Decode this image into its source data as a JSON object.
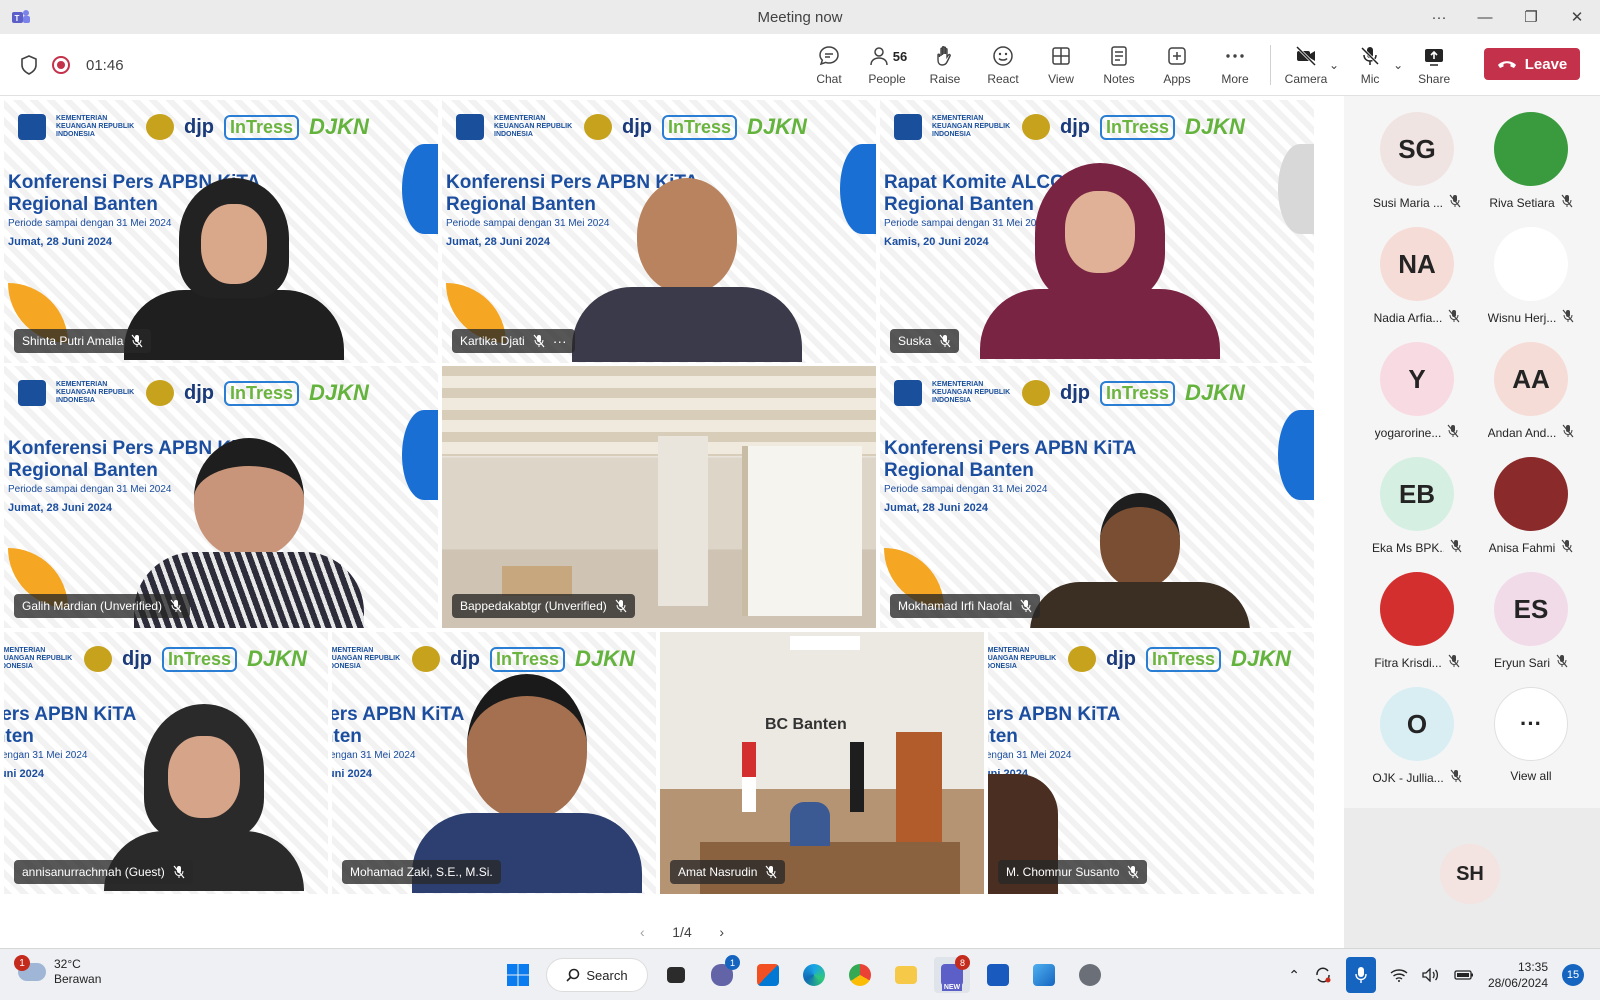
{
  "window": {
    "title": "Meeting now"
  },
  "toolbar": {
    "timer": "01:46",
    "chat": "Chat",
    "people": "People",
    "people_count": "56",
    "raise": "Raise",
    "react": "React",
    "view": "View",
    "notes": "Notes",
    "apps": "Apps",
    "more": "More",
    "camera": "Camera",
    "mic": "Mic",
    "share": "Share",
    "leave": "Leave"
  },
  "banner": {
    "org_small": "KEMENTERIAN KEUANGAN REPUBLIK INDONESIA",
    "djp": "djp",
    "intress": "InTress",
    "djkn": "DJKN",
    "headline_a": "Konferensi Pers APBN KiTA",
    "headline_b": "Regional Banten",
    "period": "Periode sampai dengan 31 Mei 2024",
    "date": "Jumat, 28 Juni 2024",
    "headline_alco": "Rapat Komite ALCO",
    "date_alco": "Kamis, 20 Juni 2024"
  },
  "tiles": [
    {
      "name": "Shinta Putri Amalia"
    },
    {
      "name": "Kartika Djati"
    },
    {
      "name": "Suska"
    },
    {
      "name": "Galih Mardian (Unverified)"
    },
    {
      "name": "Bappedakabtgr (Unverified)"
    },
    {
      "name": "Mokhamad Irfi Naofal"
    },
    {
      "name": "annisanurrachmah (Guest)"
    },
    {
      "name": "Mohamad Zaki, S.E., M.Si."
    },
    {
      "name": "Amat Nasrudin"
    },
    {
      "name": "M. Chomnur Susanto"
    }
  ],
  "office_text": "BC Banten",
  "pager": {
    "label": "1/4"
  },
  "roster": [
    {
      "initials": "SG",
      "name": "Susi Maria ...",
      "bg": "#f0e4e2"
    },
    {
      "initials": "",
      "name": "Riva Setiara",
      "bg": "#3a9b3e"
    },
    {
      "initials": "NA",
      "name": "Nadia Arfia...",
      "bg": "#f6dcd6"
    },
    {
      "initials": "",
      "name": "Wisnu Herj...",
      "bg": "#ffffff"
    },
    {
      "initials": "Y",
      "name": "yogarorine...",
      "bg": "#f8dbe2"
    },
    {
      "initials": "AA",
      "name": "Andan And...",
      "bg": "#f6dcd6"
    },
    {
      "initials": "EB",
      "name": "Eka Ms BPK...",
      "bg": "#d6efe3"
    },
    {
      "initials": "",
      "name": "Anisa Fahmi",
      "bg": "#8a2a2a"
    },
    {
      "initials": "",
      "name": "Fitra Krisdi...",
      "bg": "#d32f2f"
    },
    {
      "initials": "ES",
      "name": "Eryun Sari",
      "bg": "#f1dbe8"
    },
    {
      "initials": "O",
      "name": "OJK - Jullia...",
      "bg": "#d8eef3"
    }
  ],
  "roster_view_all": "View all",
  "roster_bottom": {
    "initials": "SH"
  },
  "taskbar": {
    "weather_temp": "32°C",
    "weather_desc": "Berawan",
    "weather_badge": "1",
    "search": "Search",
    "chat_badge": "1",
    "teams_badge": "8",
    "teams_new": "NEW",
    "time": "13:35",
    "date": "28/06/2024",
    "notif_count": "15"
  }
}
